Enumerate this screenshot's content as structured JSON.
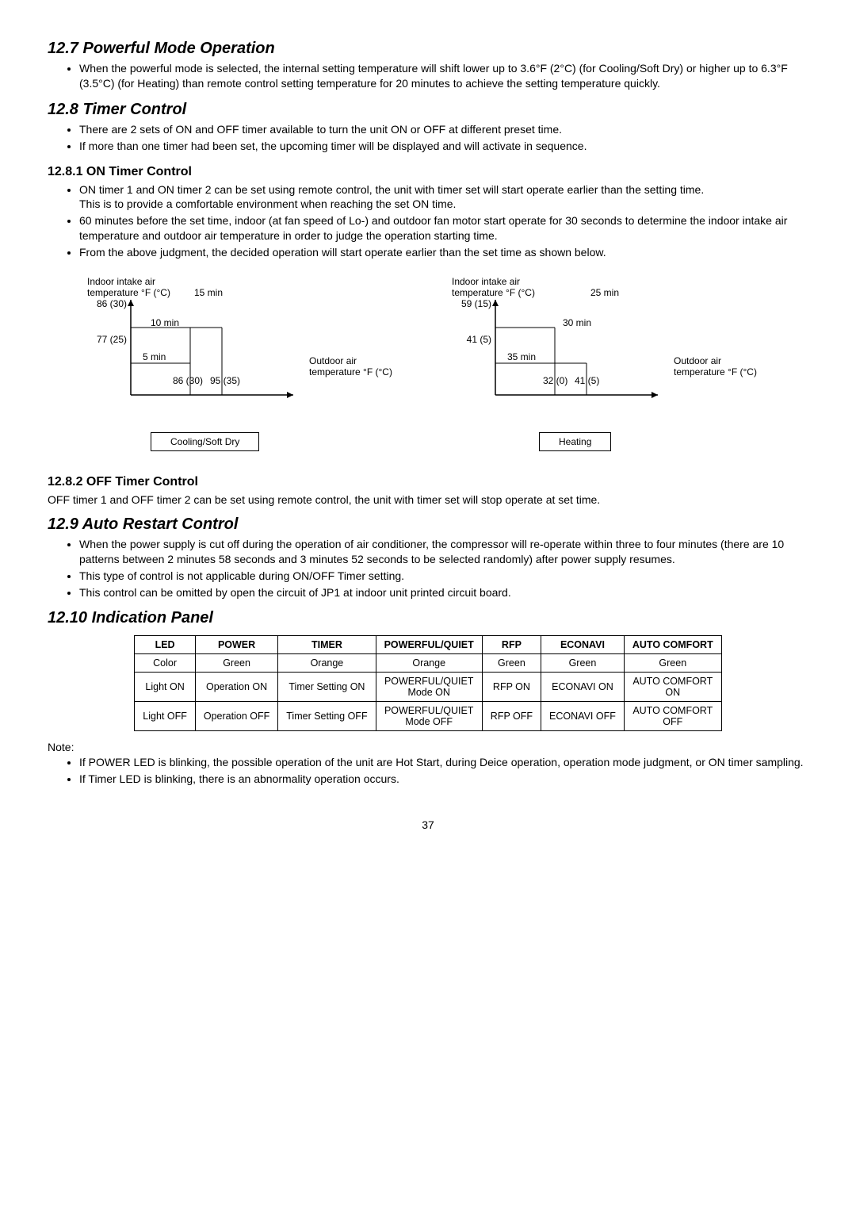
{
  "sections": {
    "powerful": {
      "heading": "12.7  Powerful Mode Operation",
      "bullet1": "When the powerful mode is selected, the internal setting temperature will shift lower up to 3.6°F (2°C) (for Cooling/Soft Dry) or higher up to 6.3°F (3.5°C) (for Heating) than remote control setting temperature for 20 minutes to achieve the setting temperature quickly."
    },
    "timer": {
      "heading": "12.8  Timer Control",
      "bullet1": "There are 2 sets of ON and OFF timer available to turn the unit ON or OFF at different preset time.",
      "bullet2": "If more than one timer had been set, the upcoming timer will be displayed and will activate in sequence."
    },
    "on_timer": {
      "heading": "12.8.1    ON Timer Control",
      "bullet1": "ON timer 1 and ON timer 2 can be set using remote control, the unit with timer set will start operate earlier than the setting time.",
      "bullet1_sub": "This is to provide a comfortable environment when reaching the set ON time.",
      "bullet2": "60 minutes before the set time, indoor (at fan speed of Lo-) and outdoor fan motor start operate for 30 seconds to determine the indoor intake air temperature and outdoor air temperature in order to judge the operation starting time.",
      "bullet3": "From the above judgment, the decided operation will start operate earlier than the set time as shown below."
    },
    "off_timer": {
      "heading": "12.8.2    OFF Timer Control",
      "text": "OFF timer 1 and OFF timer 2 can be set using remote control, the unit with timer set will stop operate at set time."
    },
    "auto_restart": {
      "heading": "12.9  Auto Restart Control",
      "bullet1": "When the power supply is cut off during the operation of air conditioner, the compressor will re-operate within three to four minutes (there are 10 patterns between 2 minutes 58 seconds and 3 minutes 52 seconds to be selected randomly) after power supply resumes.",
      "bullet2": "This type of control is not applicable during ON/OFF Timer setting.",
      "bullet3": "This control can be omitted by open the circuit of JP1 at indoor unit printed circuit board."
    },
    "indication": {
      "heading": "12.10  Indication Panel",
      "note_label": "Note:",
      "note_bullet1": "If POWER LED is blinking, the possible operation of the unit are Hot Start, during Deice operation, operation mode judgment, or ON timer sampling.",
      "note_bullet2": "If Timer LED is blinking, there is an abnormality operation occurs."
    }
  },
  "diagram_labels": {
    "indoor_y": "Indoor intake air\ntemperature °F (°C)",
    "outdoor_x": "Outdoor air\ntemperature °F (°C)"
  },
  "chart_data": [
    {
      "type": "grid-threshold",
      "title": "Cooling/Soft Dry",
      "x_axis": "Outdoor air temperature °F (°C)",
      "y_axis": "Indoor intake air temperature °F (°C)",
      "y_ticks": [
        "86 (30)",
        "77 (25)"
      ],
      "x_ticks": [
        "86 (30)",
        "95 (35)"
      ],
      "regions": [
        {
          "zone": "top",
          "value": "15 min"
        },
        {
          "zone": "mid-left",
          "value": "10 min"
        },
        {
          "zone": "bottom-left",
          "value": "5 min"
        }
      ],
      "mode_box": "Cooling/Soft Dry"
    },
    {
      "type": "grid-threshold",
      "title": "Heating",
      "x_axis": "Outdoor air temperature °F (°C)",
      "y_axis": "Indoor intake air temperature °F (°C)",
      "y_ticks": [
        "59 (15)",
        "41 (5)"
      ],
      "x_ticks": [
        "32 (0)",
        "41 (5)"
      ],
      "regions": [
        {
          "zone": "top-right",
          "value": "25 min"
        },
        {
          "zone": "mid-right",
          "value": "30 min"
        },
        {
          "zone": "bottom",
          "value": "35 min"
        }
      ],
      "mode_box": "Heating"
    }
  ],
  "led_table": {
    "headers": [
      "LED",
      "POWER",
      "TIMER",
      "POWERFUL/QUIET",
      "RFP",
      "ECONAVI",
      "AUTO COMFORT"
    ],
    "rows": [
      [
        "Color",
        "Green",
        "Orange",
        "Orange",
        "Green",
        "Green",
        "Green"
      ],
      [
        "Light ON",
        "Operation ON",
        "Timer Setting ON",
        "POWERFUL/QUIET Mode ON",
        "RFP ON",
        "ECONAVI ON",
        "AUTO COMFORT ON"
      ],
      [
        "Light OFF",
        "Operation OFF",
        "Timer Setting OFF",
        "POWERFUL/QUIET Mode OFF",
        "RFP OFF",
        "ECONAVI OFF",
        "AUTO COMFORT OFF"
      ]
    ]
  },
  "page_number": "37"
}
